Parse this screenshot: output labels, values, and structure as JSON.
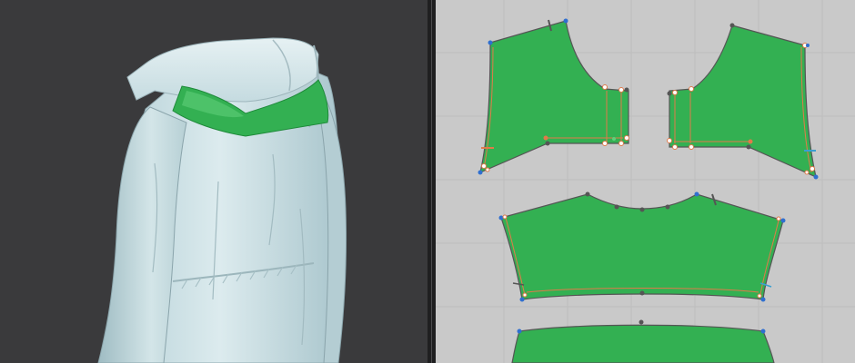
{
  "app": {
    "panels": [
      {
        "id": "3d",
        "type": "3d-garment-view",
        "garment": "hooded-jacket",
        "view": "back-three-quarter"
      },
      {
        "id": "2d",
        "type": "2d-pattern-window",
        "pieces": [
          "back-yoke-left",
          "back-yoke-right",
          "back-panel",
          "back-lower-panel"
        ]
      }
    ],
    "colors": {
      "viewport_3d_bg": "#3a3a3c",
      "viewport_2d_bg": "#c9c9c9",
      "fabric_base": "#d3e6ea",
      "selected_fabric": "#33b052",
      "seam_line": "#e07a4a",
      "point_blue": "#2f6fd0"
    }
  }
}
